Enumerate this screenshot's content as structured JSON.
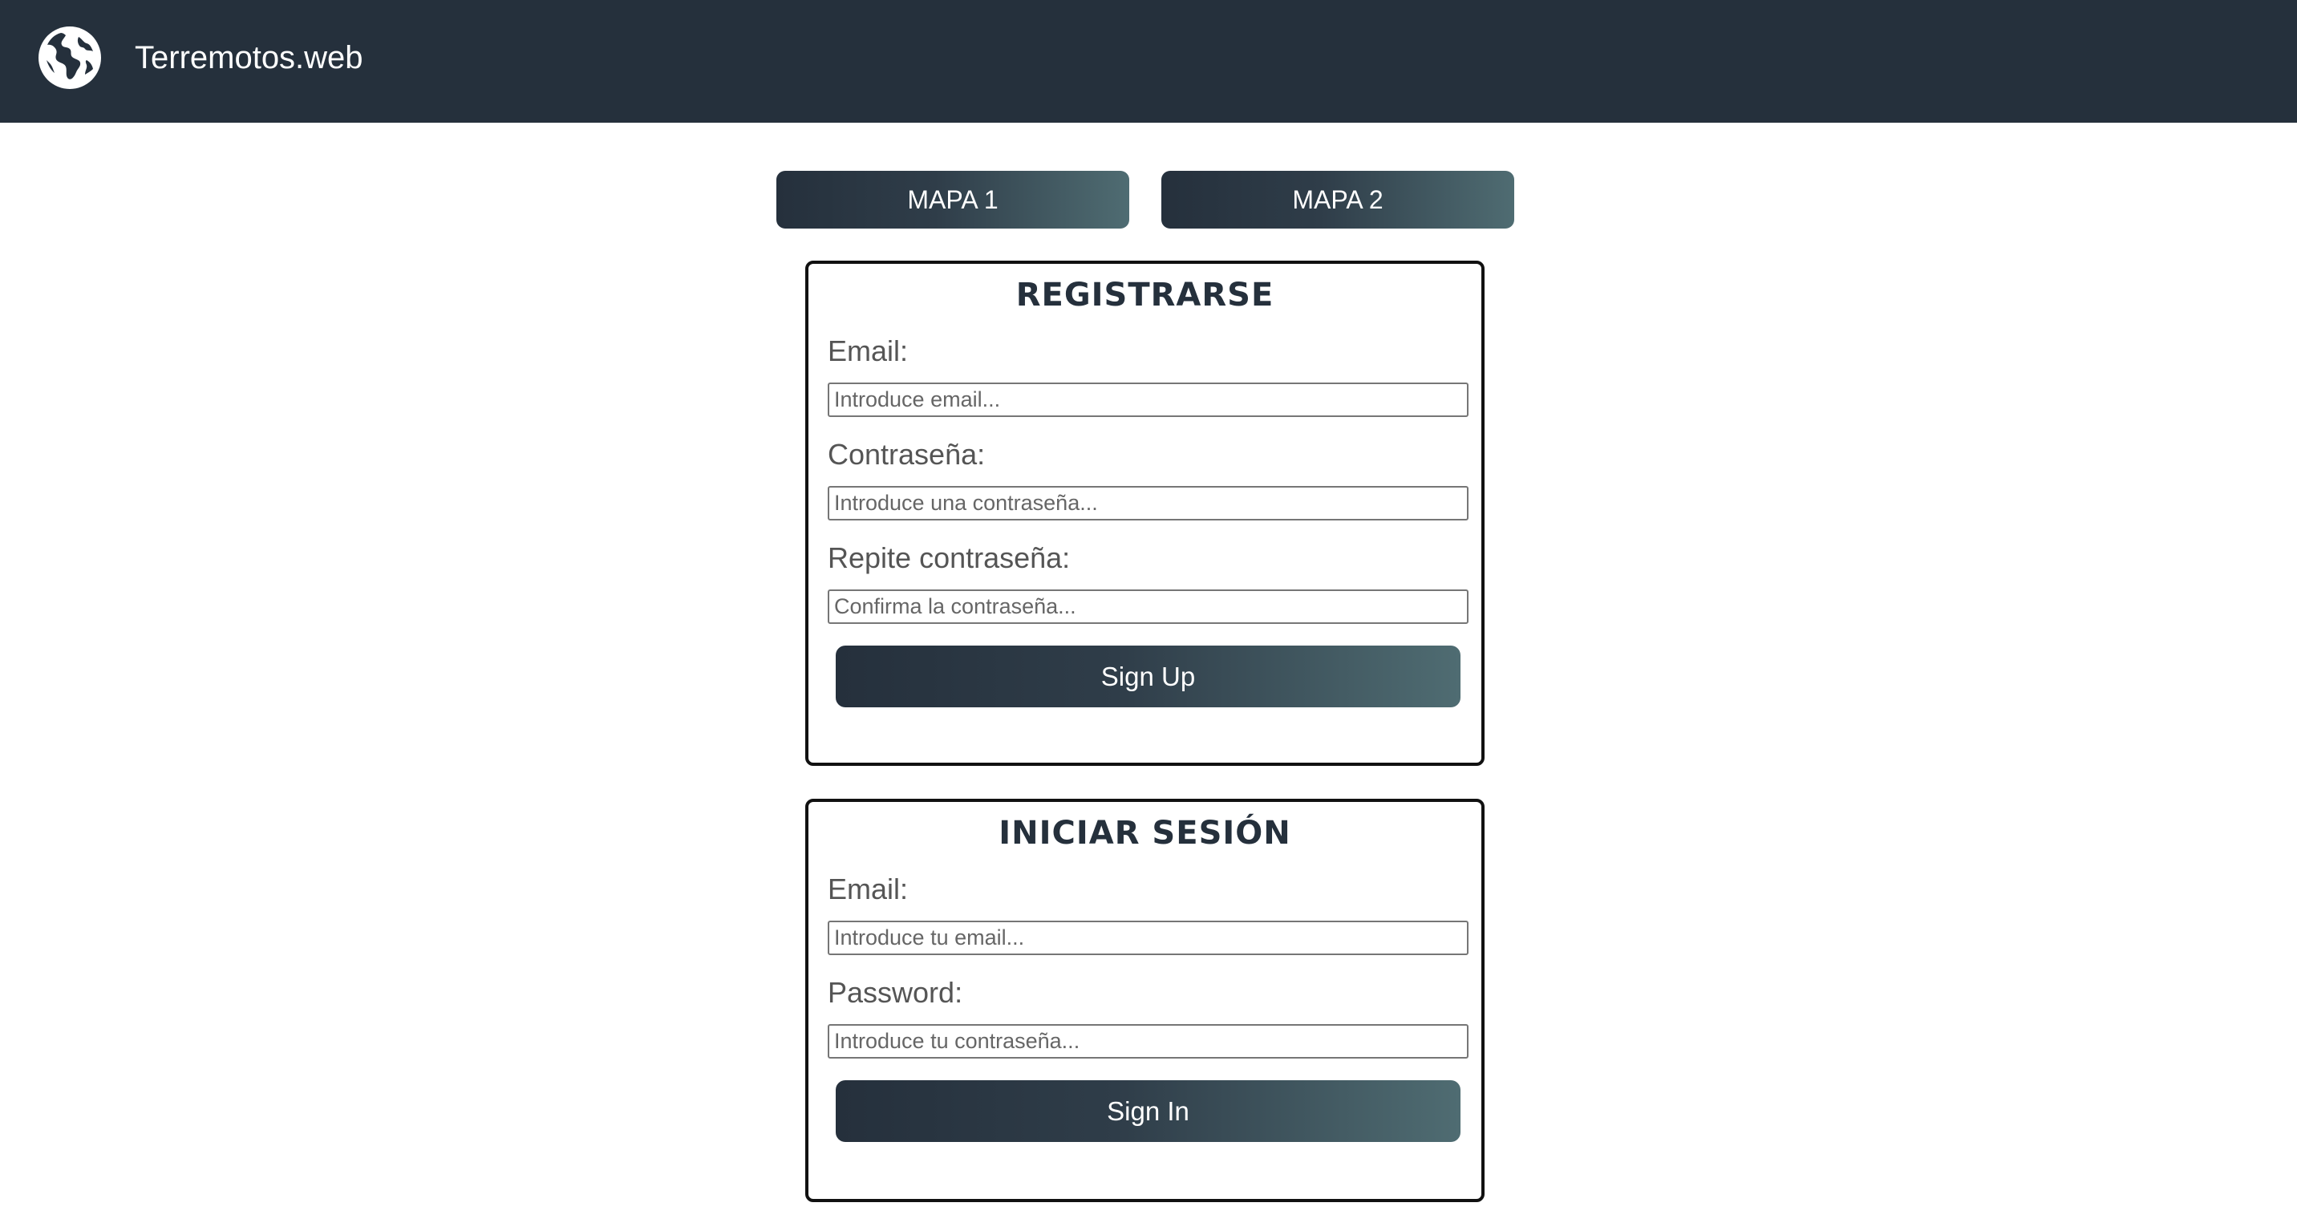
{
  "header": {
    "title": "Terremotos.web",
    "logo_icon": "globe-icon"
  },
  "nav": {
    "map1_label": "MAPA 1",
    "map2_label": "MAPA 2"
  },
  "register": {
    "title": "REGISTRARSE",
    "email_label": "Email:",
    "email_placeholder": "Introduce email...",
    "password_label": "Contraseña:",
    "password_placeholder": "Introduce una contraseña...",
    "repeat_label": "Repite contraseña:",
    "repeat_placeholder": "Confirma la contraseña...",
    "submit_label": "Sign Up"
  },
  "login": {
    "title": "INICIAR SESIÓN",
    "email_label": "Email:",
    "email_placeholder": "Introduce tu email...",
    "password_label": "Password:",
    "password_placeholder": "Introduce tu contraseña...",
    "submit_label": "Sign In"
  },
  "colors": {
    "header_bg": "#25303c",
    "button_gradient_start": "#25303c",
    "button_gradient_end": "#4f6c72"
  }
}
